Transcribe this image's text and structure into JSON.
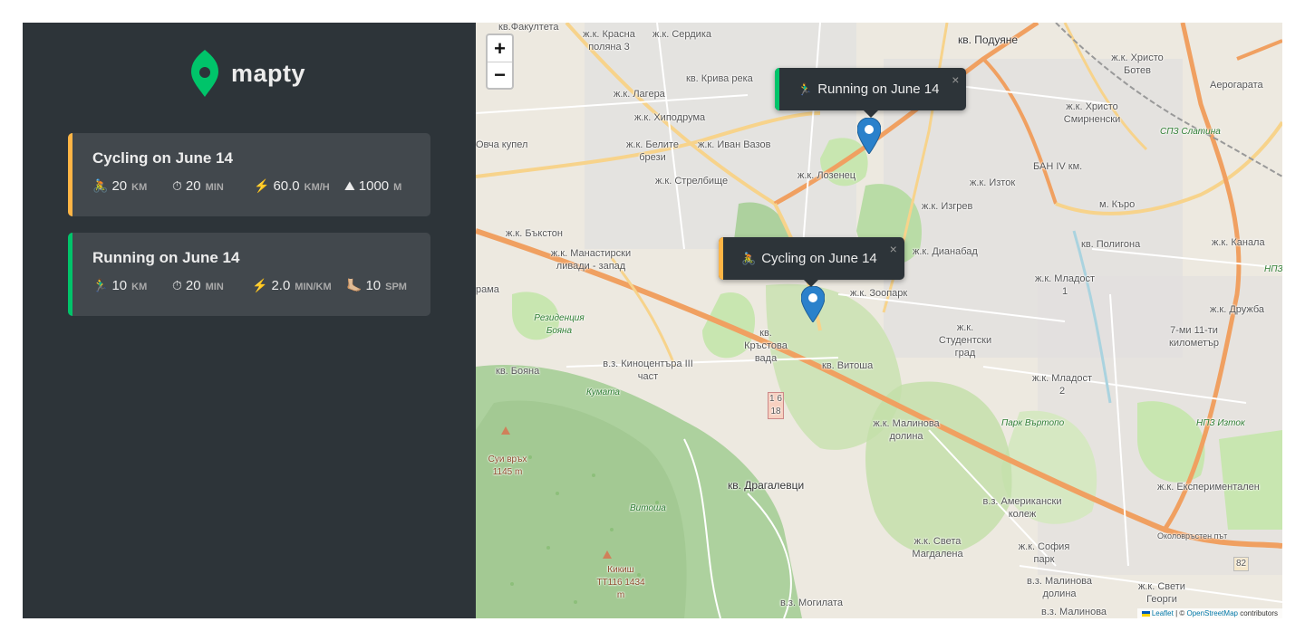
{
  "logo": {
    "text": "mapty"
  },
  "workouts": [
    {
      "type": "cycling",
      "title": "Cycling on June 14",
      "details": [
        {
          "icon": "🚴",
          "value": "20",
          "unit": "km"
        },
        {
          "icon": "⏱",
          "value": "20",
          "unit": "min"
        },
        {
          "icon": "⚡️",
          "value": "60.0",
          "unit": "km/h"
        },
        {
          "icon": "⛰",
          "value": "1000",
          "unit": "m"
        }
      ]
    },
    {
      "type": "running",
      "title": "Running on June 14",
      "details": [
        {
          "icon": "🏃‍♂️",
          "value": "10",
          "unit": "km"
        },
        {
          "icon": "⏱",
          "value": "20",
          "unit": "min"
        },
        {
          "icon": "⚡️",
          "value": "2.0",
          "unit": "min/km"
        },
        {
          "icon": "🦶🏼",
          "value": "10",
          "unit": "spm"
        }
      ]
    }
  ],
  "map": {
    "zoom_in": "+",
    "zoom_out": "−",
    "popups": [
      {
        "type": "running",
        "emoji": "🏃‍♂️",
        "text": "Running on June 14",
        "close": "×"
      },
      {
        "type": "cycling",
        "emoji": "🚴",
        "text": "Cycling on June 14",
        "close": "×"
      }
    ],
    "attribution": {
      "leaflet": "Leaflet",
      "sep": " | © ",
      "osm": "OpenStreetMap",
      "rest": " contributors"
    },
    "labels": [
      "кв.Факултета",
      "ж.к. Красна поляна 3",
      "ж.к. Сердика",
      "кв. Подуяне",
      "ж.к. Христо Ботев",
      "Аерогарата",
      "ж.к. Лагера",
      "кв. Крива река",
      "ж.к. Хиподрума",
      "ж.к. Христо Смирненски",
      "Овча купел",
      "ж.к. Белите брези",
      "ж.к. Иван Вазов",
      "СПЗ Слатина",
      "ж.к. Стрелбище",
      "ж.к. Лозенец",
      "БАН IV км.",
      "ж.к. Изток",
      "ж.к. Изгрев",
      "м. Къро",
      "ж.к. Бъкстон",
      "ж.к. Манастирски ливади - запад",
      "ж.к. Дианабад",
      "кв. Полигона",
      "ж.к. Канала",
      "НПЗ",
      "рама",
      "ж.к. Младост 1",
      "ж.к. Дружба",
      "Резиденция Бояна",
      "ж.к. Зоопарк",
      "ж.к. Студентски град",
      "кв. Кръстова вада",
      "7-ми 11-ти километър",
      "в.з. Киноцентъра III част",
      "кв. Бояна",
      "кв. Витоша",
      "ж.к. Младост 2",
      "Кумата",
      "ж.к. Малинова долина",
      "Парк Въртопо",
      "НПЗ Изток",
      "Суи връх 1145 m",
      "кв. Драгалевци",
      "Витоша",
      "в.з. Американски колеж",
      "ж.к. Експериментален",
      "ж.к. Света Магдалена",
      "ж.к. София парк",
      "Кикиш ТТ116 1434 m",
      "в.з. Малинова долина",
      "ж.к. Свети Георги",
      "в.з. Могилата",
      "в.з. Малинова",
      "Околовръстен път",
      "82",
      "1 6 18"
    ]
  }
}
